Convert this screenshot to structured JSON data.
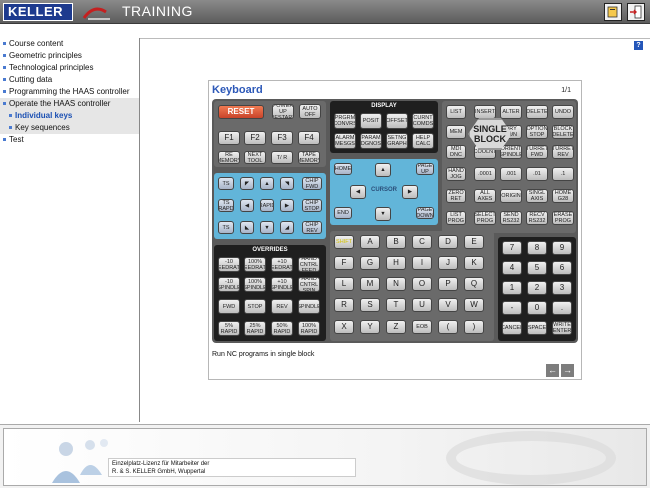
{
  "header": {
    "logo_text": "KELLER",
    "app_title": "TRAINING",
    "buttons": [
      {
        "icon": "book-help-icon"
      },
      {
        "icon": "exit-door-icon"
      }
    ]
  },
  "help_label": "?",
  "nav": {
    "items": [
      {
        "label": "Course content"
      },
      {
        "label": "Geometric principles"
      },
      {
        "label": "Technological principles"
      },
      {
        "label": "Cutting data"
      },
      {
        "label": "Programming the HAAS controller"
      },
      {
        "label": "Operate the HAAS controller"
      },
      {
        "label": "Individual keys"
      },
      {
        "label": "Key sequences"
      },
      {
        "label": "Test"
      }
    ]
  },
  "panel": {
    "title": "Keyboard",
    "page": "1/1",
    "caption": "Run NC programs in single block",
    "prev_label": "←",
    "next_label": "→"
  },
  "keyboard": {
    "reset": "RESET",
    "power_on": "POWER UP RESTART",
    "auto_off": "AUTO OFF",
    "display_label": "DISPLAY",
    "overrides_label": "OVERRIDES",
    "single_block": "SINGLE BLOCK",
    "function_keys": [
      "F1",
      "F2",
      "F3",
      "F4"
    ],
    "display_keys": [
      "PRGRM CONVRS",
      "POSIT",
      "OFFSET",
      "CURNT COMDS",
      "ALARM MESGS",
      "PARAM DGNOS",
      "SETNG GRAPH",
      "HELP CALC"
    ],
    "edit_keys": [
      "LIST",
      "INSERT",
      "ALTER",
      "DELETE",
      "UNDO",
      "MEM",
      "DRY RUN",
      "OPTION STOP",
      "BLOCK DELETE",
      "MDI DNC",
      "COOLNT",
      "ORIENT SPINDLE",
      "TURRET FWD",
      "TURRET REV",
      "HAND JOG",
      ".0001",
      ".001",
      ".01",
      ".1",
      "ZERO RET",
      "ALL AXES",
      "ORIGIN",
      "SINGL AXIS",
      "HOME G28",
      "LIST PROG",
      "SELECT PROG",
      "SEND RS232",
      "RECV RS232",
      "ERASE PROG"
    ],
    "cursor_label": "CURSOR",
    "cursor_keys": [
      "HOME",
      "PAGE UP",
      "END",
      "PAGE DOWN"
    ],
    "jog_keys": [
      "TS",
      "TS RAPD",
      "TS",
      "CHIP FWD",
      "RAPID",
      "CHIP STOP",
      "CHIP REV"
    ],
    "override_keys": [
      "-10 FEEDRATE",
      "100% FEEDRATE",
      "+10 FEEDRATE",
      "HAND CNTRL FEED",
      "-10 SPINDLE",
      "100% SPINDLE",
      "+10 SPINDLE",
      "HAND CNTRL SPIN",
      "FWD",
      "STOP",
      "REV",
      "SPINDLE",
      "5% RAPID",
      "25% RAPID",
      "50% RAPID",
      "100% RAPID"
    ],
    "letters": [
      "SHIFT",
      "A",
      "B",
      "C",
      "D",
      "E",
      "F",
      "G",
      "H",
      "I",
      "J",
      "K",
      "L",
      "M",
      "N",
      "O",
      "P",
      "Q",
      "R",
      "S",
      "T",
      "U",
      "V",
      "W",
      "X",
      "Y",
      "Z",
      "EOB",
      "(",
      ")"
    ],
    "numbers": [
      "7",
      "8",
      "9",
      "4",
      "5",
      "6",
      "1",
      "2",
      "3",
      "-",
      "0",
      ".",
      "CANCEL",
      "SPACE",
      "WRITE ENTER"
    ],
    "misc_keys": [
      "RE MEMORY",
      "NEXT TOOL",
      "T/ R",
      "TAPE MEMORY"
    ]
  },
  "footer": {
    "license_line1": "Einzelplatz-Lizenz für Mitarbeiter der",
    "license_line2": "R. & S. KELLER GmbH, Wuppertal"
  },
  "colors": {
    "header_bg": "#6e6e6e",
    "accent_blue": "#2c58b8",
    "reset_red": "#e8603a",
    "jog_blue": "#62b5d9",
    "single_block_bg": "#d9d9d9"
  }
}
